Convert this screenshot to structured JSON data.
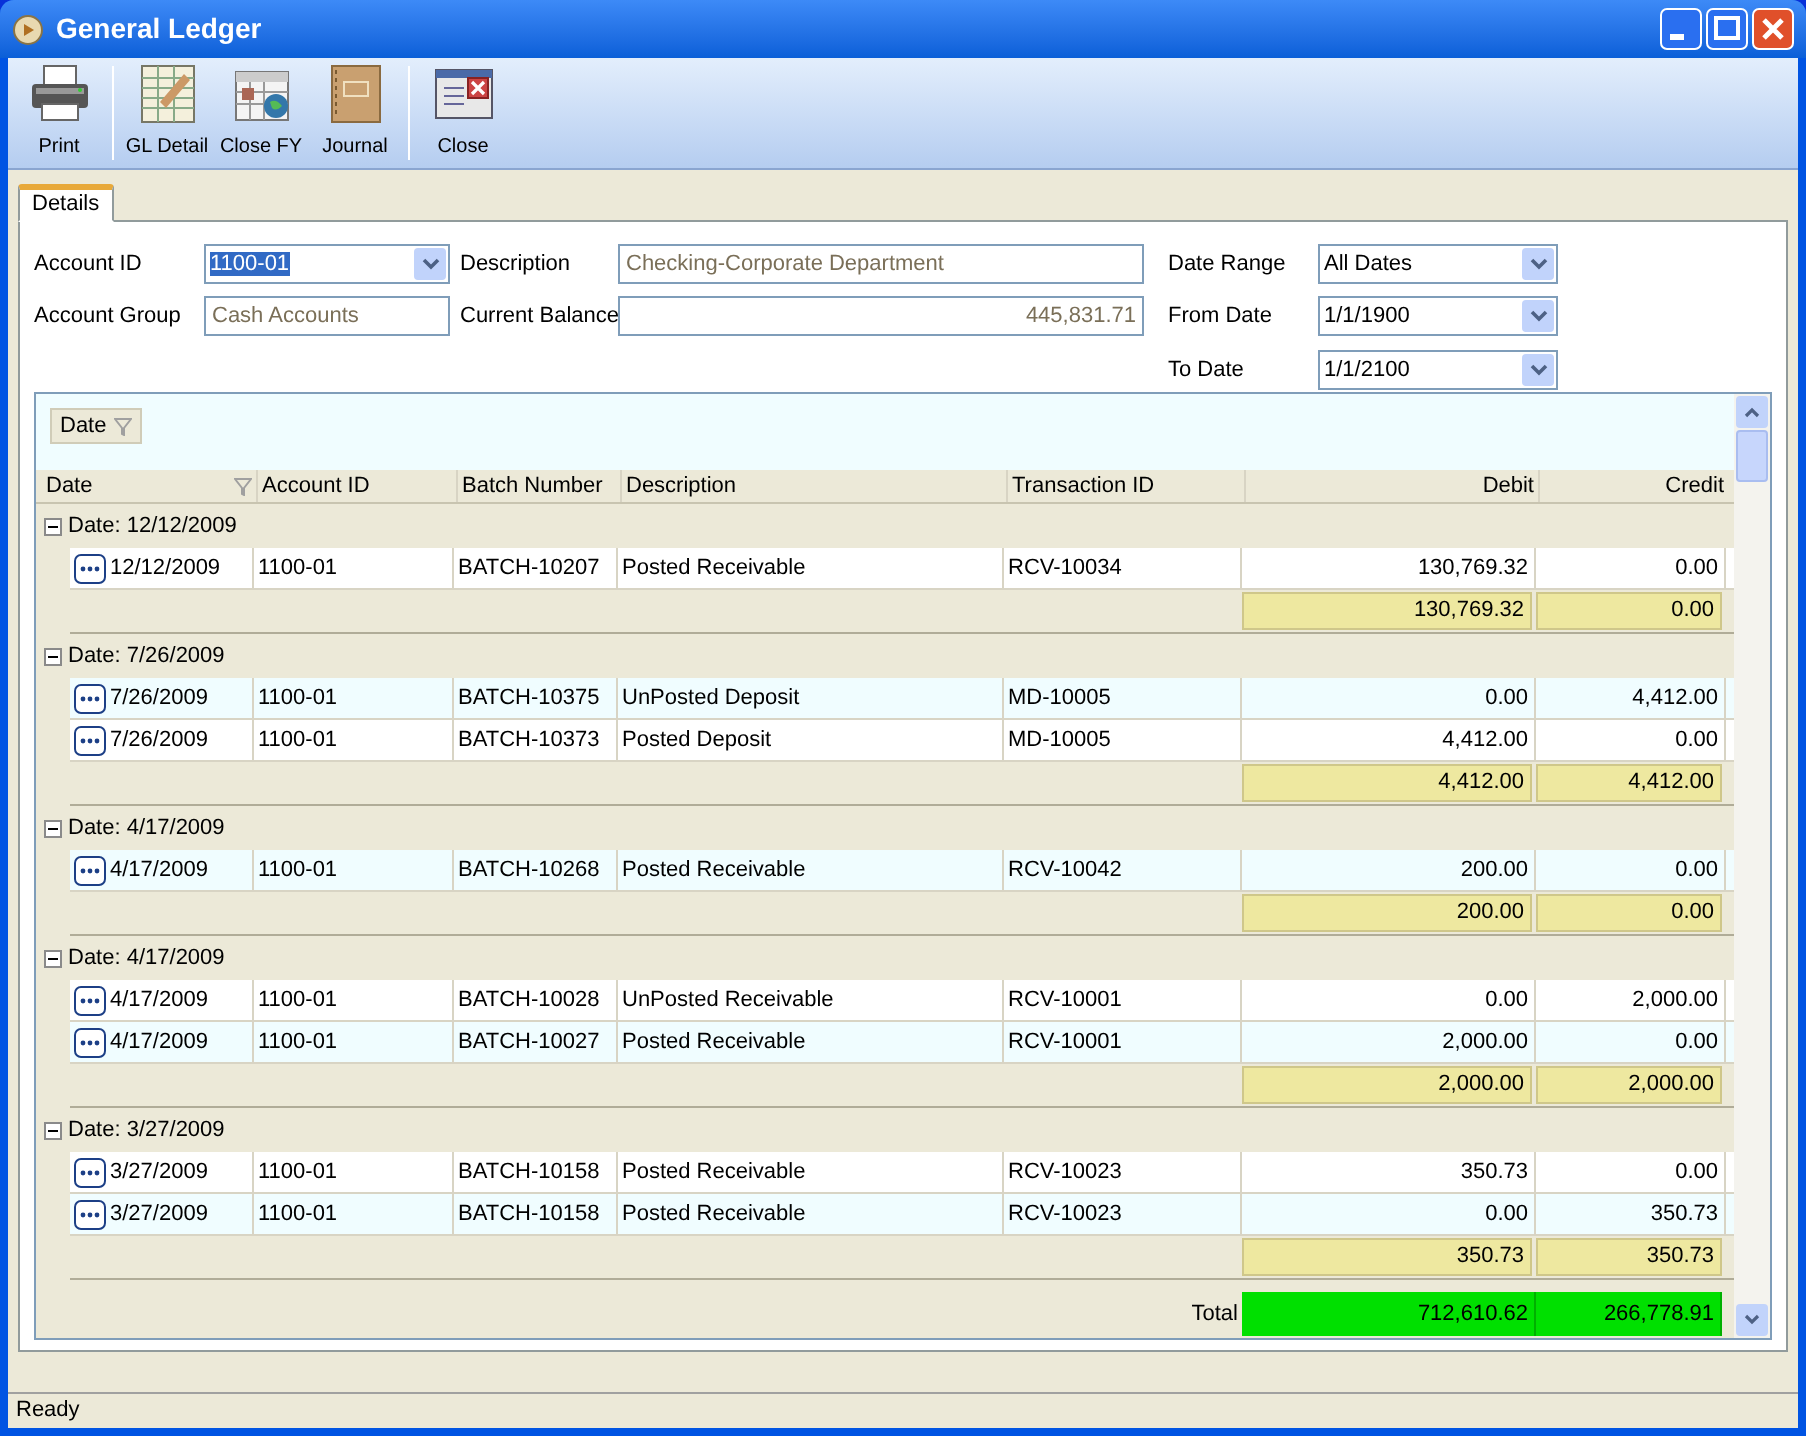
{
  "window": {
    "title": "General Ledger"
  },
  "toolbar_groups": [
    {
      "buttons": [
        {
          "label": "Print",
          "kind": "printer"
        }
      ]
    },
    {
      "buttons": [
        {
          "label": "GL Detail",
          "kind": "sheet"
        },
        {
          "label": "Close FY",
          "kind": "calendar"
        },
        {
          "label": "Journal",
          "kind": "notebook"
        }
      ]
    },
    {
      "buttons": [
        {
          "label": "Close",
          "kind": "close"
        }
      ]
    }
  ],
  "tabs": [
    {
      "label": "Details",
      "selected": true
    }
  ],
  "form": {
    "account_id": {
      "label": "Account ID",
      "value": "1100-01",
      "text_selected": true
    },
    "account_group": {
      "label": "Account Group",
      "value": "Cash Accounts"
    },
    "description": {
      "label": "Description",
      "value": "Checking-Corporate Department"
    },
    "current_balance": {
      "label": "Current Balance",
      "value": "445,831.71"
    },
    "date_range": {
      "label": "Date Range",
      "value": "All Dates"
    },
    "from_date": {
      "label": "From Date",
      "value": "1/1/1900"
    },
    "to_date": {
      "label": "To Date",
      "value": "1/1/2100"
    }
  },
  "grid": {
    "group_by": [
      "Date"
    ],
    "columns": [
      "Date",
      "Account ID",
      "Batch Number",
      "Description",
      "Transaction ID",
      "Debit",
      "Credit"
    ],
    "groups": [
      {
        "header": "Date: 12/12/2009",
        "expanded": true,
        "rows": [
          [
            "12/12/2009",
            "1100-01",
            "BATCH-10207",
            "Posted Receivable",
            "RCV-10034",
            "130,769.32",
            "0.00"
          ]
        ],
        "debit_sum": "130,769.32",
        "credit_sum": "0.00"
      },
      {
        "header": "Date: 7/26/2009",
        "expanded": true,
        "rows": [
          [
            "7/26/2009",
            "1100-01",
            "BATCH-10375",
            "UnPosted Deposit",
            "MD-10005",
            "0.00",
            "4,412.00"
          ],
          [
            "7/26/2009",
            "1100-01",
            "BATCH-10373",
            "Posted Deposit",
            "MD-10005",
            "4,412.00",
            "0.00"
          ]
        ],
        "debit_sum": "4,412.00",
        "credit_sum": "4,412.00"
      },
      {
        "header": "Date: 4/17/2009",
        "expanded": true,
        "rows": [
          [
            "4/17/2009",
            "1100-01",
            "BATCH-10268",
            "Posted Receivable",
            "RCV-10042",
            "200.00",
            "0.00"
          ]
        ],
        "debit_sum": "200.00",
        "credit_sum": "0.00"
      },
      {
        "header": "Date: 4/17/2009",
        "expanded": true,
        "rows": [
          [
            "4/17/2009",
            "1100-01",
            "BATCH-10028",
            "UnPosted Receivable",
            "RCV-10001",
            "0.00",
            "2,000.00"
          ],
          [
            "4/17/2009",
            "1100-01",
            "BATCH-10027",
            "Posted Receivable",
            "RCV-10001",
            "2,000.00",
            "0.00"
          ]
        ],
        "debit_sum": "2,000.00",
        "credit_sum": "2,000.00"
      },
      {
        "header": "Date: 3/27/2009",
        "expanded": true,
        "rows": [
          [
            "3/27/2009",
            "1100-01",
            "BATCH-10158",
            "Posted Receivable",
            "RCV-10023",
            "350.73",
            "0.00"
          ],
          [
            "3/27/2009",
            "1100-01",
            "BATCH-10158",
            "Posted Receivable",
            "RCV-10023",
            "0.00",
            "350.73"
          ]
        ],
        "debit_sum": "350.73",
        "credit_sum": "350.73"
      }
    ],
    "total": {
      "label": "Total",
      "debit": "712,610.62",
      "credit": "266,778.91"
    }
  },
  "status_bar": {
    "text": "Ready"
  }
}
